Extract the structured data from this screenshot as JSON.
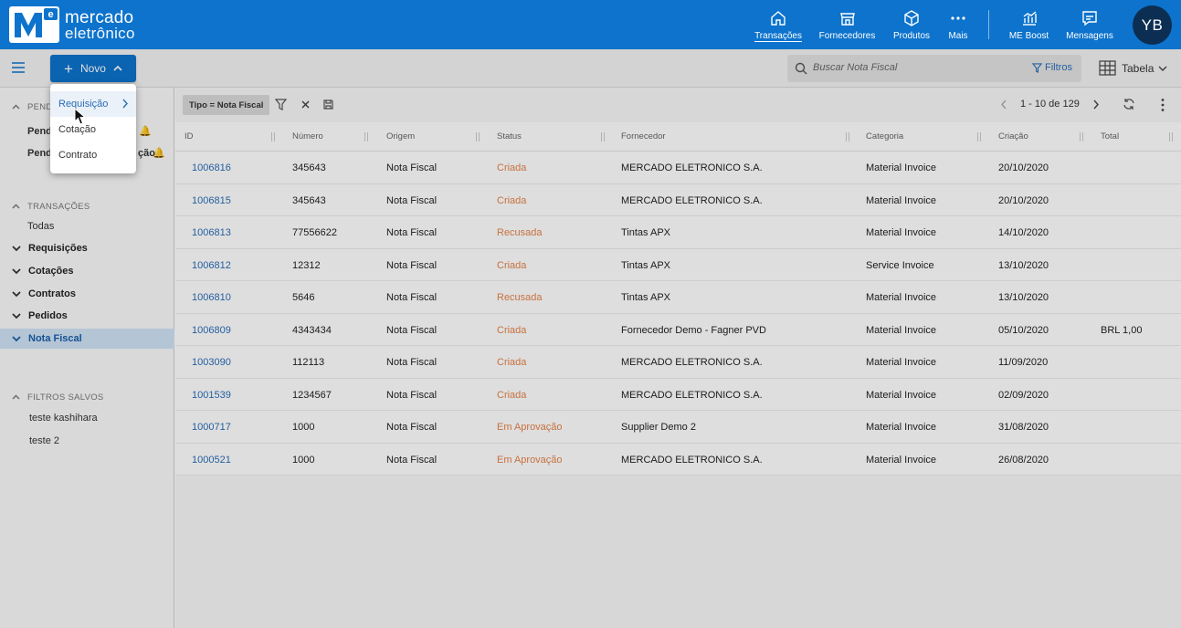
{
  "brand": {
    "line1": "mercado",
    "line2": "eletrônico"
  },
  "nav": [
    {
      "label": "Transações",
      "icon": "home-icon",
      "active": true
    },
    {
      "label": "Fornecedores",
      "icon": "store-icon"
    },
    {
      "label": "Produtos",
      "icon": "box-icon"
    },
    {
      "label": "Mais",
      "icon": "more-icon"
    },
    {
      "label": "ME Boost",
      "icon": "chart-icon"
    },
    {
      "label": "Mensagens",
      "icon": "message-icon"
    }
  ],
  "user": {
    "initials": "YB"
  },
  "toolbar": {
    "novo_label": "Novo",
    "search_placeholder": "Buscar Nota Fiscal",
    "filtros_label": "Filtros",
    "view_label": "Tabela"
  },
  "dropdown": {
    "items": [
      "Requisição",
      "Cotação",
      "Contrato"
    ]
  },
  "sidebar": {
    "pending_section": "PEND",
    "pending_items": [
      "Pend",
      "Pend"
    ],
    "pending_item2_suffix": "ção",
    "transacoes_section": "TRANSAÇÕES",
    "todas": "Todas",
    "groups": [
      "Requisições",
      "Cotações",
      "Contratos",
      "Pedidos",
      "Nota Fiscal"
    ],
    "filtros_section": "FILTROS SALVOS",
    "saved_filters": [
      "teste kashihara",
      "teste 2"
    ]
  },
  "filter": {
    "chip": "Tipo = Nota Fiscal"
  },
  "pagination": {
    "text": "1 - 10 de 129"
  },
  "table": {
    "columns": [
      "ID",
      "Número",
      "Origem",
      "Status",
      "Fornecedor",
      "Categoria",
      "Criação",
      "Total"
    ],
    "rows": [
      [
        "1006816",
        "345643",
        "Nota Fiscal",
        "Criada",
        "MERCADO ELETRONICO S.A.",
        "Material Invoice",
        "20/10/2020",
        ""
      ],
      [
        "1006815",
        "345643",
        "Nota Fiscal",
        "Criada",
        "MERCADO ELETRONICO S.A.",
        "Material Invoice",
        "20/10/2020",
        ""
      ],
      [
        "1006813",
        "77556622",
        "Nota Fiscal",
        "Recusada",
        "Tintas APX",
        "Material Invoice",
        "14/10/2020",
        ""
      ],
      [
        "1006812",
        "12312",
        "Nota Fiscal",
        "Criada",
        "Tintas APX",
        "Service Invoice",
        "13/10/2020",
        ""
      ],
      [
        "1006810",
        "5646",
        "Nota Fiscal",
        "Recusada",
        "Tintas APX",
        "Material Invoice",
        "13/10/2020",
        ""
      ],
      [
        "1006809",
        "4343434",
        "Nota Fiscal",
        "Criada",
        "Fornecedor Demo - Fagner PVD",
        "Material Invoice",
        "05/10/2020",
        "BRL 1,00"
      ],
      [
        "1003090",
        "112113",
        "Nota Fiscal",
        "Criada",
        "MERCADO ELETRONICO S.A.",
        "Material Invoice",
        "11/09/2020",
        ""
      ],
      [
        "1001539",
        "1234567",
        "Nota Fiscal",
        "Criada",
        "MERCADO ELETRONICO S.A.",
        "Material Invoice",
        "02/09/2020",
        ""
      ],
      [
        "1000717",
        "1000",
        "Nota Fiscal",
        "Em Aprovação",
        "Supplier Demo 2",
        "Material Invoice",
        "31/08/2020",
        ""
      ],
      [
        "1000521",
        "1000",
        "Nota Fiscal",
        "Em Aprovação",
        "MERCADO ELETRONICO S.A.",
        "Material Invoice",
        "26/08/2020",
        ""
      ]
    ]
  },
  "colors": {
    "brand_blue": "#0d73cc",
    "status_orange": "#e5844a",
    "link_blue": "#2a6eb8"
  }
}
